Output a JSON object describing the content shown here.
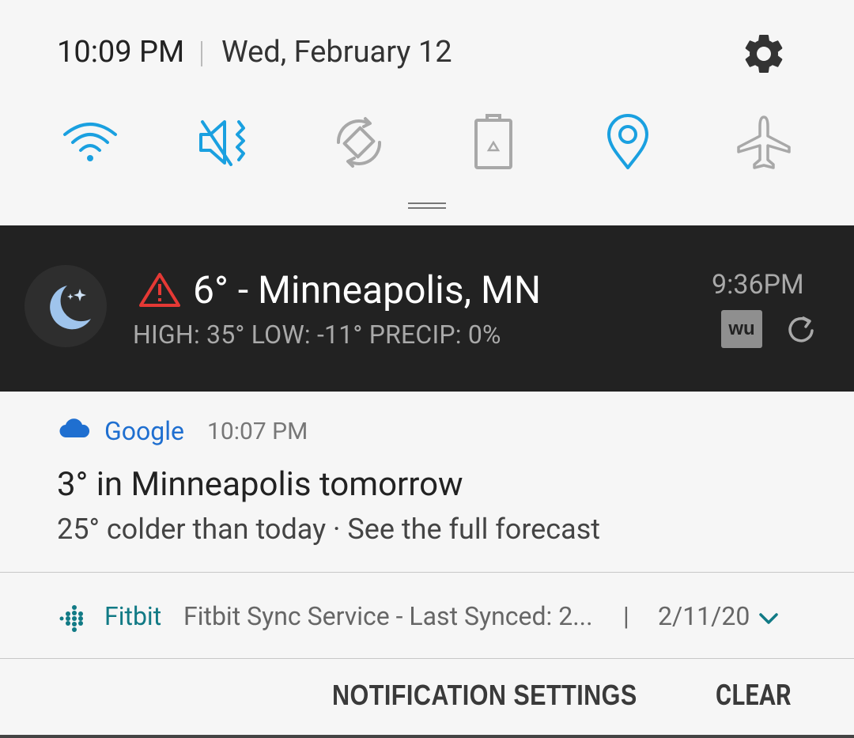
{
  "header": {
    "time": "10:09 PM",
    "date": "Wed, February 12"
  },
  "quick_settings": [
    {
      "name": "wifi",
      "icon": "wifi-icon",
      "state": "on"
    },
    {
      "name": "sound",
      "icon": "vibrate-mute-icon",
      "state": "on"
    },
    {
      "name": "auto-rotate",
      "icon": "auto-rotate-icon",
      "state": "off"
    },
    {
      "name": "power-saving",
      "icon": "battery-saver-icon",
      "state": "off"
    },
    {
      "name": "location",
      "icon": "location-icon",
      "state": "on"
    },
    {
      "name": "airplane-mode",
      "icon": "airplane-icon",
      "state": "off"
    }
  ],
  "weather": {
    "title": "6° - Minneapolis, MN",
    "subtitle": "HIGH: 35° LOW: -11° PRECIP: 0%",
    "time": "9:36PM",
    "badge": "wu"
  },
  "google": {
    "app": "Google",
    "time": "10:07 PM",
    "title": "3° in Minneapolis tomorrow",
    "text": "25° colder than today · See the full forecast"
  },
  "fitbit": {
    "app": "Fitbit",
    "text": "Fitbit Sync Service - Last Synced: 2...",
    "separator": "|",
    "date": "2/11/20"
  },
  "actions": {
    "settings": "NOTIFICATION SETTINGS",
    "clear": "CLEAR"
  },
  "colors": {
    "accent_on": "#1aa0e0",
    "icon_off": "#a8a8a8",
    "google_blue": "#1f6fd0",
    "fitbit_teal": "#117a85",
    "warning_red": "#e53935"
  }
}
